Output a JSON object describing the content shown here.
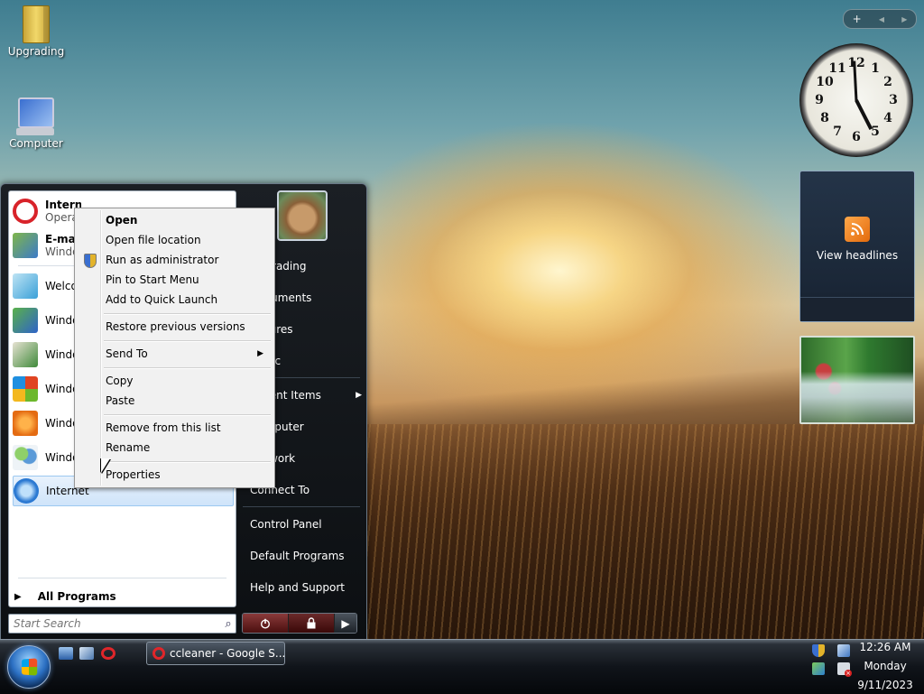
{
  "desktop": {
    "icons": [
      {
        "label": "Upgrading"
      },
      {
        "label": "Computer"
      }
    ]
  },
  "sidebar": {
    "controls": {
      "add": "+",
      "prev": "◀",
      "next": "▶"
    },
    "clock": {
      "numerals": [
        "12",
        "1",
        "2",
        "3",
        "4",
        "5",
        "6",
        "7",
        "8",
        "9",
        "10",
        "11"
      ]
    },
    "feed": {
      "label": "View headlines"
    }
  },
  "start_menu": {
    "pinned": [
      {
        "name": "Internet",
        "sub": "Opera"
      },
      {
        "name": "E-mail",
        "sub": "Windows Mail"
      }
    ],
    "recent": [
      {
        "name": "Welcome Center"
      },
      {
        "name": "Windows Easy Transfer"
      },
      {
        "name": "Windows Ultimate Extras"
      },
      {
        "name": "Windows Media Center"
      },
      {
        "name": "Windows Media Player"
      },
      {
        "name": "Windows Meeting Space"
      },
      {
        "name": "Internet"
      }
    ],
    "all_programs": "All Programs",
    "search_placeholder": "Start Search",
    "right_items": [
      {
        "label": "Upgrading"
      },
      {
        "label": "Documents"
      },
      {
        "label": "Pictures"
      },
      {
        "label": "Music"
      },
      {
        "label": "Recent Items"
      },
      {
        "label": "Computer"
      },
      {
        "label": "Network"
      },
      {
        "label": "Connect To"
      },
      {
        "label": "Control Panel"
      },
      {
        "label": "Default Programs"
      },
      {
        "label": "Help and Support"
      }
    ]
  },
  "context_menu": {
    "items": [
      {
        "label": "Open"
      },
      {
        "label": "Open file location"
      },
      {
        "label": "Run as administrator"
      },
      {
        "label": "Pin to Start Menu"
      },
      {
        "label": "Add to Quick Launch"
      },
      {
        "label": "Restore previous versions"
      },
      {
        "label": "Send To"
      },
      {
        "label": "Copy"
      },
      {
        "label": "Paste"
      },
      {
        "label": "Remove from this list"
      },
      {
        "label": "Rename"
      },
      {
        "label": "Properties"
      }
    ]
  },
  "taskbar": {
    "task_button": "ccleaner - Google S...",
    "time": "12:26 AM",
    "day": "Monday",
    "date": "9/11/2023"
  }
}
